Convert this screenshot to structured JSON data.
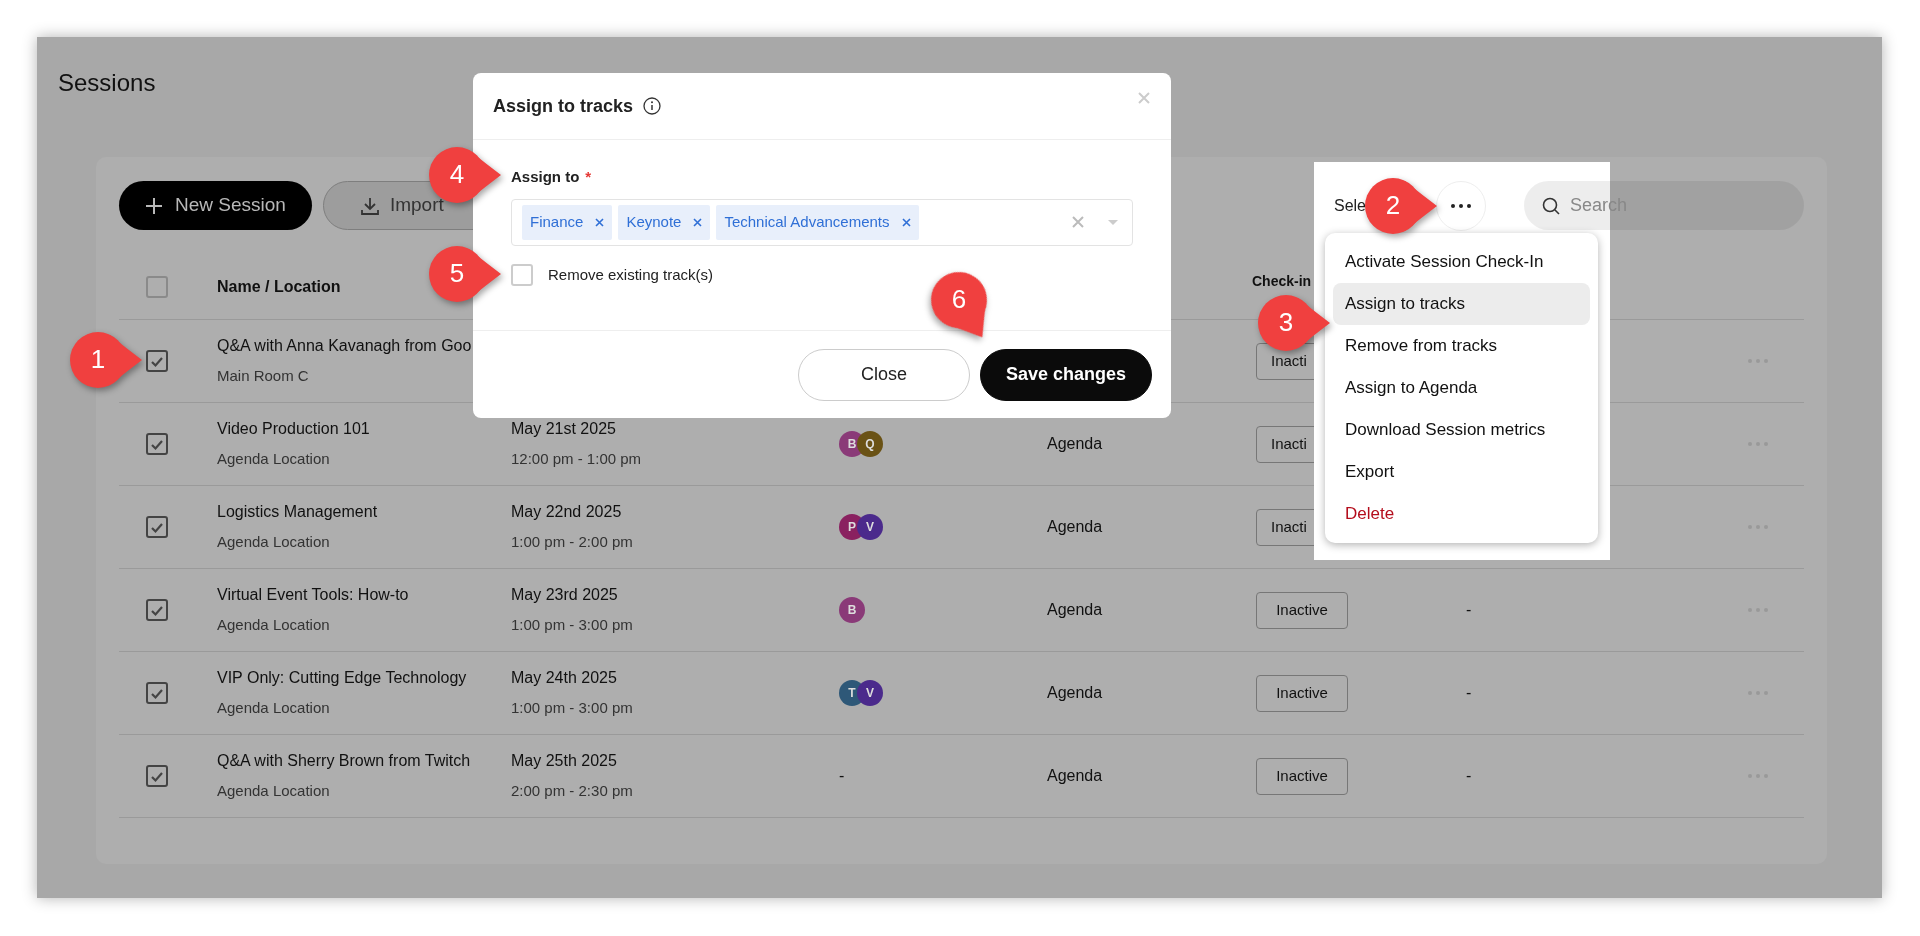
{
  "page": {
    "title": "Sessions"
  },
  "toolbar": {
    "new_button": "New Session",
    "import_button": "Import",
    "selected_label": "Sele",
    "search": {
      "placeholder": "Search"
    }
  },
  "table": {
    "select_all_checked": false,
    "name_column": "Name / Location",
    "checkin_column": "Check-in",
    "rows": [
      {
        "checked": true,
        "name": "Q&A with Anna Kavanagh from Goo",
        "location": "Main Room C",
        "checkin": "Inacti",
        "covered": true
      },
      {
        "checked": true,
        "name": "Video Production 101",
        "location": "Agenda Location",
        "date": "May 21st 2025",
        "time": "12:00 pm - 1:00 pm",
        "tracks": [
          {
            "initial": "B",
            "color": "#8a3a78"
          },
          {
            "initial": "Q",
            "color": "#6a5215"
          }
        ],
        "type": "Agenda",
        "checkin": "Inacti",
        "covered": true
      },
      {
        "checked": true,
        "name": "Logistics Management",
        "location": "Agenda Location",
        "date": "May 22nd 2025",
        "time": "1:00 pm - 2:00 pm",
        "tracks": [
          {
            "initial": "P",
            "color": "#8a2160"
          },
          {
            "initial": "V",
            "color": "#4b2a8c"
          }
        ],
        "type": "Agenda",
        "checkin": "Inacti",
        "covered": true
      },
      {
        "checked": true,
        "name": "Virtual Event Tools: How-to",
        "location": "Agenda Location",
        "date": "May 23rd 2025",
        "time": "1:00 pm - 3:00 pm",
        "tracks": [
          {
            "initial": "B",
            "color": "#8a3a78"
          }
        ],
        "type": "Agenda",
        "checkin": "Inactive",
        "covered": false,
        "extra": "-"
      },
      {
        "checked": true,
        "name": "VIP Only: Cutting Edge Technology",
        "location": "Agenda Location",
        "date": "May 24th 2025",
        "time": "1:00 pm - 3:00 pm",
        "tracks": [
          {
            "initial": "T",
            "color": "#2e5878"
          },
          {
            "initial": "V",
            "color": "#4b2a8c"
          }
        ],
        "type": "Agenda",
        "checkin": "Inactive",
        "covered": false,
        "extra": "-"
      },
      {
        "checked": true,
        "name": "Q&A with Sherry Brown from Twitch",
        "location": "Agenda Location",
        "date": "May 25th 2025",
        "time": "2:00 pm - 2:30 pm",
        "tracks_text": "-",
        "type": "Agenda",
        "checkin": "Inactive",
        "covered": false,
        "extra": "-"
      }
    ]
  },
  "dropdown_menu": {
    "items": [
      {
        "label": "Activate Session Check-In",
        "selected": false,
        "danger": false
      },
      {
        "label": "Assign to tracks",
        "selected": true,
        "danger": false
      },
      {
        "label": "Remove from tracks",
        "selected": false,
        "danger": false
      },
      {
        "label": "Assign to Agenda",
        "selected": false,
        "danger": false
      },
      {
        "label": "Download Session metrics",
        "selected": false,
        "danger": false
      },
      {
        "label": "Export",
        "selected": false,
        "danger": false
      },
      {
        "label": "Delete",
        "selected": false,
        "danger": true
      }
    ]
  },
  "modal": {
    "title": "Assign to tracks",
    "field_label": "Assign to",
    "required_mark": "*",
    "tags": [
      {
        "label": "Finance"
      },
      {
        "label": "Keynote"
      },
      {
        "label": "Technical Advancements"
      }
    ],
    "checkbox": {
      "label": "Remove existing track(s)",
      "checked": false
    },
    "buttons": [
      {
        "label": "Close",
        "kind": "secondary"
      },
      {
        "label": "Save changes",
        "kind": "primary"
      }
    ]
  },
  "callouts": [
    {
      "label": "1",
      "tilted": false
    },
    {
      "label": "2",
      "tilted": false
    },
    {
      "label": "3",
      "tilted": false
    },
    {
      "label": "4",
      "tilted": false
    },
    {
      "label": "5",
      "tilted": false
    },
    {
      "label": "6",
      "tilted": true
    }
  ]
}
